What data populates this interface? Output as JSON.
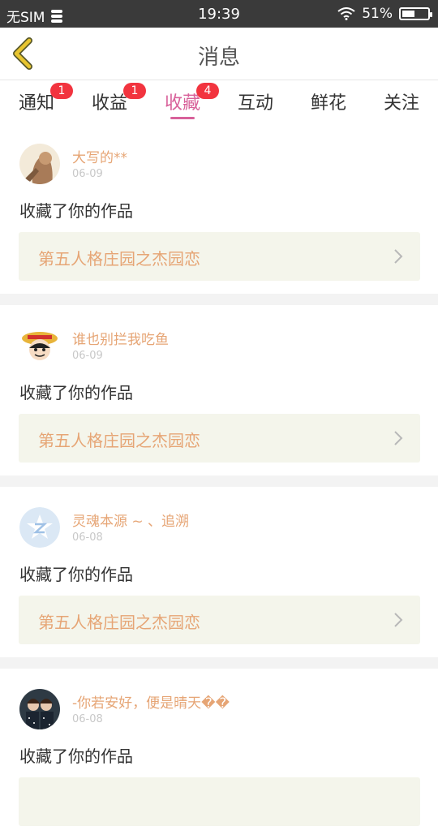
{
  "status_bar": {
    "carrier": "无SIM",
    "time": "19:39",
    "battery": "51%",
    "battery_level": 0.51
  },
  "header": {
    "title": "消息",
    "back_icon": "chevron-left-icon",
    "accent_color": "#e8c530"
  },
  "tabs": [
    {
      "label": "通知",
      "badge": "1"
    },
    {
      "label": "收益",
      "badge": "1"
    },
    {
      "label": "收藏",
      "badge": "4",
      "active": true
    },
    {
      "label": "互动"
    },
    {
      "label": "鲜花"
    },
    {
      "label": "关注"
    }
  ],
  "colors": {
    "active_tab": "#d8619a",
    "badge": "#f2343f",
    "username": "#e6a575",
    "link_bg": "#f4f5eb"
  },
  "messages": [
    {
      "username": "大写的**",
      "date": "06-09",
      "action": "收藏了你的作品",
      "work_title": "第五人格庄园之杰园恋"
    },
    {
      "username": "谁也别拦我吃鱼",
      "date": "06-09",
      "action": "收藏了你的作品",
      "work_title": "第五人格庄园之杰园恋"
    },
    {
      "username": "灵魂本源 ~ 、追溯",
      "date": "06-08",
      "action": "收藏了你的作品",
      "work_title": "第五人格庄园之杰园恋"
    },
    {
      "username": "-你若安好，便是晴天��",
      "date": "06-08",
      "action": "收藏了你的作品",
      "work_title": ""
    }
  ]
}
